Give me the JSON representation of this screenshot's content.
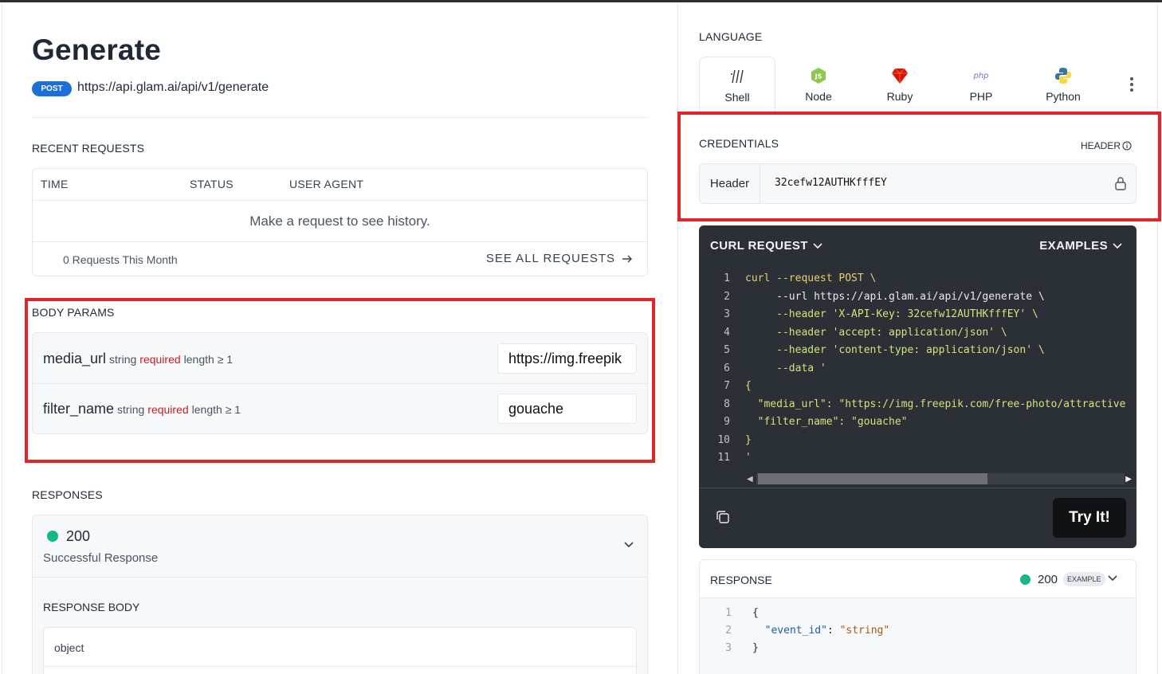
{
  "page": {
    "title": "Generate",
    "method": "POST",
    "url": "https://api.glam.ai/api/v1/generate"
  },
  "recent_requests": {
    "label": "RECENT REQUESTS",
    "columns": [
      "TIME",
      "STATUS",
      "USER AGENT"
    ],
    "empty_text": "Make a request to see history.",
    "count_text": "0 Requests This Month",
    "see_all": "SEE ALL REQUESTS"
  },
  "body_params": {
    "label": "BODY PARAMS",
    "params": [
      {
        "name": "media_url",
        "type": "string",
        "required": "required",
        "constraint": "length ≥ 1",
        "value": "https://img.freepik"
      },
      {
        "name": "filter_name",
        "type": "string",
        "required": "required",
        "constraint": "length ≥ 1",
        "value": "gouache"
      }
    ]
  },
  "responses": {
    "label": "RESPONSES",
    "code": "200",
    "description": "Successful Response",
    "body_label": "RESPONSE BODY",
    "body_type": "object"
  },
  "language": {
    "label": "LANGUAGE",
    "tabs": [
      "Shell",
      "Node",
      "Ruby",
      "PHP",
      "Python"
    ],
    "php_icon_text": "php",
    "node_icon_text": "JS",
    "active": "Shell"
  },
  "credentials": {
    "label": "CREDENTIALS",
    "header_toggle": "HEADER",
    "key_label": "Header",
    "key_value": "32cefw12AUTHKfffEY"
  },
  "curl": {
    "title": "CURL REQUEST",
    "examples_label": "EXAMPLES",
    "line_numbers": [
      "1",
      "2",
      "3",
      "4",
      "5",
      "6",
      "7",
      "8",
      "9",
      "10",
      "11"
    ],
    "lines": [
      "curl --request POST \\",
      "     --url https://api.glam.ai/api/v1/generate \\",
      "     --header 'X-API-Key: 32cefw12AUTHKfffEY' \\",
      "     --header 'accept: application/json' \\",
      "     --header 'content-type: application/json' \\",
      "     --data '",
      "{",
      "  \"media_url\": \"https://img.freepik.com/free-photo/attractive",
      "  \"filter_name\": \"gouache\"",
      "}",
      "'"
    ],
    "try_label": "Try It!"
  },
  "response_panel": {
    "label": "RESPONSE",
    "code": "200",
    "badge": "EXAMPLE",
    "line_numbers": [
      "1",
      "2",
      "3"
    ],
    "lines": [
      "{",
      "  \"event_id\": \"string\"",
      "}"
    ]
  },
  "colors": {
    "accent_blue": "#1d6fd6",
    "success_green": "#12b886",
    "required_red": "#c81e1e",
    "highlight_red": "#e0242b",
    "code_bg": "#2b3036"
  }
}
